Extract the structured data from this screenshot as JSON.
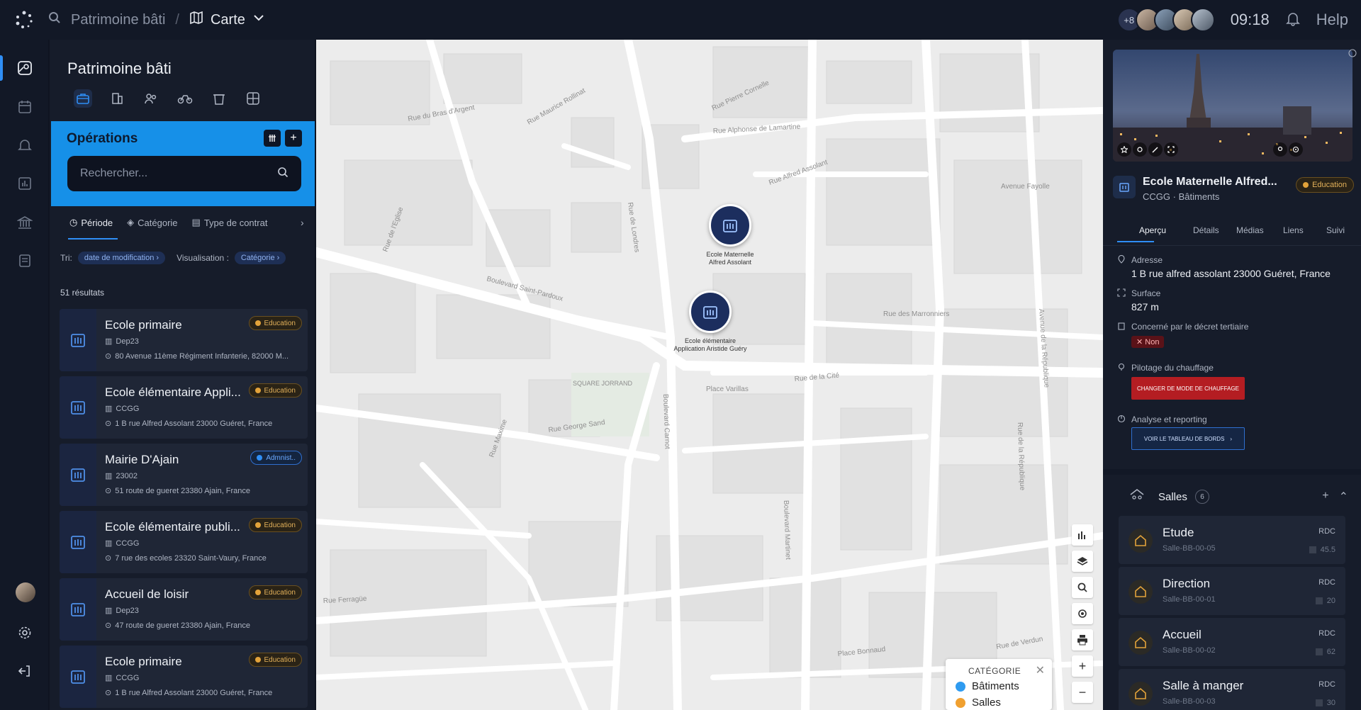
{
  "topbar": {
    "breadcrumb_root": "Patrimoine bâti",
    "breadcrumb_sep": "/",
    "breadcrumb_current": "Carte",
    "avatars_more": "+8",
    "time": "09:18",
    "help": "Help"
  },
  "left_panel": {
    "title": "Patrimoine bâti",
    "operations_title": "Opérations",
    "search_placeholder": "Rechercher...",
    "filters": [
      "Période",
      "Catégorie",
      "Type de contrat"
    ],
    "sort_label": "Tri:",
    "sort_value": "date de modification",
    "visualisation_label": "Visualisation :",
    "visualisation_value": "Catégorie",
    "results_count": "51 résultats",
    "items": [
      {
        "name": "Ecole primaire",
        "code": "Dep23",
        "address": "80 Avenue 11ème Régiment Infanterie, 82000 M...",
        "tag": "Education",
        "tag_type": "edu"
      },
      {
        "name": "Ecole élémentaire Appli...",
        "code": "CCGG",
        "address": "1 B rue Alfred Assolant 23000 Guéret, France",
        "tag": "Education",
        "tag_type": "edu"
      },
      {
        "name": "Mairie D'Ajain",
        "code": "23002",
        "address": "51 route de gueret 23380 Ajain, France",
        "tag": "Admnist..",
        "tag_type": "adm"
      },
      {
        "name": "Ecole élémentaire publi...",
        "code": "CCGG",
        "address": "7 rue des ecoles 23320 Saint-Vaury, France",
        "tag": "Education",
        "tag_type": "edu"
      },
      {
        "name": "Accueil de loisir",
        "code": "Dep23",
        "address": "47 route de gueret 23380 Ajain, France",
        "tag": "Education",
        "tag_type": "edu"
      },
      {
        "name": "Ecole primaire",
        "code": "CCGG",
        "address": "1 B rue Alfred Assolant 23000 Guéret, France",
        "tag": "Education",
        "tag_type": "edu"
      }
    ]
  },
  "map": {
    "markers": [
      {
        "label_line1": "Ecole Maternelle",
        "label_line2": "Alfred Assolant"
      },
      {
        "label_line1": "Ecole élémentaire",
        "label_line2": "Application Aristide Guéry"
      }
    ],
    "streets": [
      "Rue du Bras d'Argent",
      "Rue Maurice Rollinat",
      "Rue Alphonse de Lamartine",
      "Rue Pierre Cornelle",
      "Avenue Fayolle",
      "Rue Alfred Assolant",
      "Boulevard Saint-Pardoux",
      "Rue de l'Eglise",
      "Boulevard Carnot",
      "Rue de la Cité",
      "Place Varillas",
      "Rue George Sand",
      "SQUARE JORRAND",
      "Rue des Marronniers",
      "Rue de Londres",
      "Rue de la République",
      "Avenue de la République",
      "Rue Ferragüe",
      "Place Bonnaud",
      "Rue Maxime",
      "Rue de Verdun",
      "Boulevard Martinet"
    ],
    "legend_title": "CATÉGORIE",
    "legend_items": [
      {
        "label": "Bâtiments",
        "color": "#2f9bf0"
      },
      {
        "label": "Salles",
        "color": "#f0a030"
      }
    ]
  },
  "right_panel": {
    "title": "Ecole Maternelle Alfred...",
    "subtitle_org": "CCGG",
    "subtitle_sep": "·",
    "subtitle_type": "Bâtiments",
    "tag": "Education",
    "tabs": [
      "Aperçu",
      "Détails",
      "Médias",
      "Liens",
      "Suivi"
    ],
    "adresse_label": "Adresse",
    "adresse_value": "1 B rue alfred assolant 23000 Guéret, France",
    "surface_label": "Surface",
    "surface_value": "827 m",
    "decret_label": "Concerné par le décret tertiaire",
    "decret_value": "✕ Non",
    "chauffage_label": "Pilotage du chauffage",
    "chauffage_button": "CHANGER DE MODE DE CHAUFFAGE",
    "analyse_label": "Analyse et reporting",
    "analyse_button": "VOIR LE TABLEAU DE BORDS",
    "salles_label": "Salles",
    "salles_count": "6",
    "rooms": [
      {
        "name": "Etude",
        "code": "Salle-BB-00-05",
        "level": "RDC",
        "size": "45.5"
      },
      {
        "name": "Direction",
        "code": "Salle-BB-00-01",
        "level": "RDC",
        "size": "20"
      },
      {
        "name": "Accueil",
        "code": "Salle-BB-00-02",
        "level": "RDC",
        "size": "62"
      },
      {
        "name": "Salle à manger",
        "code": "Salle-BB-00-03",
        "level": "RDC",
        "size": "30"
      }
    ]
  },
  "colors": {
    "accent": "#1690e8",
    "education": "#e3a33a",
    "admin": "#2f8ef5",
    "danger": "#b41d22"
  }
}
